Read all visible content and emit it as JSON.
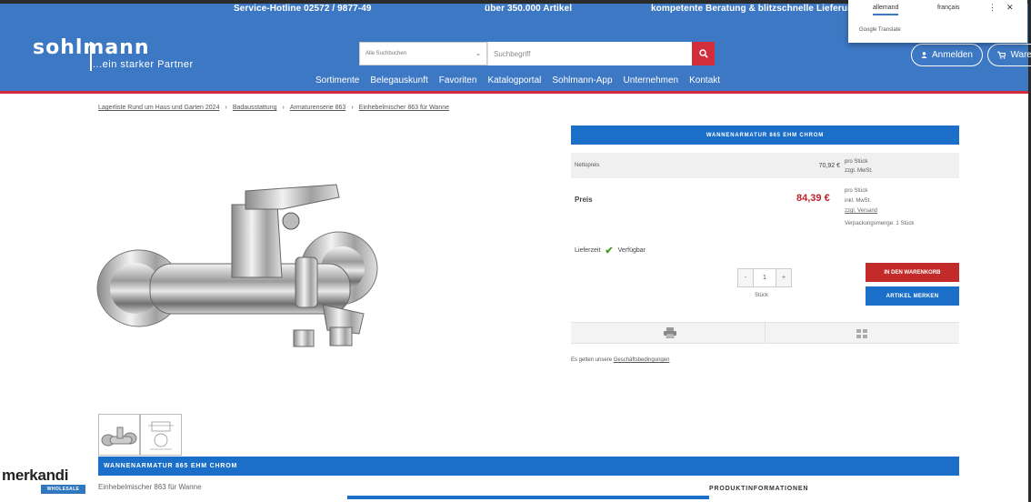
{
  "topbar": {
    "hotline": "Service-Hotline 02572 / 9877-49",
    "articles": "über 350.000 Artikel",
    "advice": "kompetente Beratung & blitzschnelle Lieferung"
  },
  "logo": {
    "main": "sohlmann",
    "tagline": "...ein starker Partner"
  },
  "search": {
    "category": "Alle Suchbuchen",
    "placeholder": "Suchbegriff"
  },
  "nav": [
    "Sortimente",
    "Belegauskunft",
    "Favoriten",
    "Katalogportal",
    "Sohlmann-App",
    "Unternehmen",
    "Kontakt"
  ],
  "header_actions": {
    "login": "Anmelden",
    "cart": "Ware"
  },
  "translate": {
    "lang_active": "allemand",
    "lang_other": "français",
    "sub": "Google Translate"
  },
  "breadcrumb": [
    "Lagerliste Rund um Haus und Garten 2024",
    "Badausstattung",
    "Armaturenserie 863",
    "Einhebelmischer 863 für Wanne"
  ],
  "product": {
    "title": "WANNENARMATUR 865 EHM CHROM",
    "netto_label": "Nettopreis",
    "netto_value": "70,92 €",
    "netto_unit_1": "pro Stück",
    "netto_unit_2": "zzgl. MwSt.",
    "price_label": "Preis",
    "price_value": "84,39 €",
    "price_unit_1": "pro Stück",
    "price_unit_2": "inkl. MwSt.",
    "price_unit_3": "zzgl. Versand",
    "packaging": "Verpackungsmenge: 1 Stück",
    "delivery_label": "Lieferzeit",
    "delivery_status": "Verfügbar",
    "qty_minus": "-",
    "qty_value": "1",
    "qty_plus": "+",
    "qty_unit": "Stück",
    "cart_button": "IN DEN WARENKORB",
    "save_button": "ARTIKEL MERKEN",
    "terms_prefix": "Es gelten unsere",
    "terms_link": "Geschäftsbedingungen"
  },
  "bottom": {
    "title": "WANNENARMATUR 865 EHM CHROM",
    "subtitle": "Einhebelmischer 863 für Wanne",
    "info_heading": "PRODUKTINFORMATIONEN"
  },
  "watermark": {
    "text": "merkandi",
    "badge": "WHOLESALE"
  },
  "colors": {
    "header_blue": "#3d78c4",
    "accent_red": "#d22d3b",
    "button_blue": "#1c6fc8",
    "price_red": "#c0202e"
  }
}
